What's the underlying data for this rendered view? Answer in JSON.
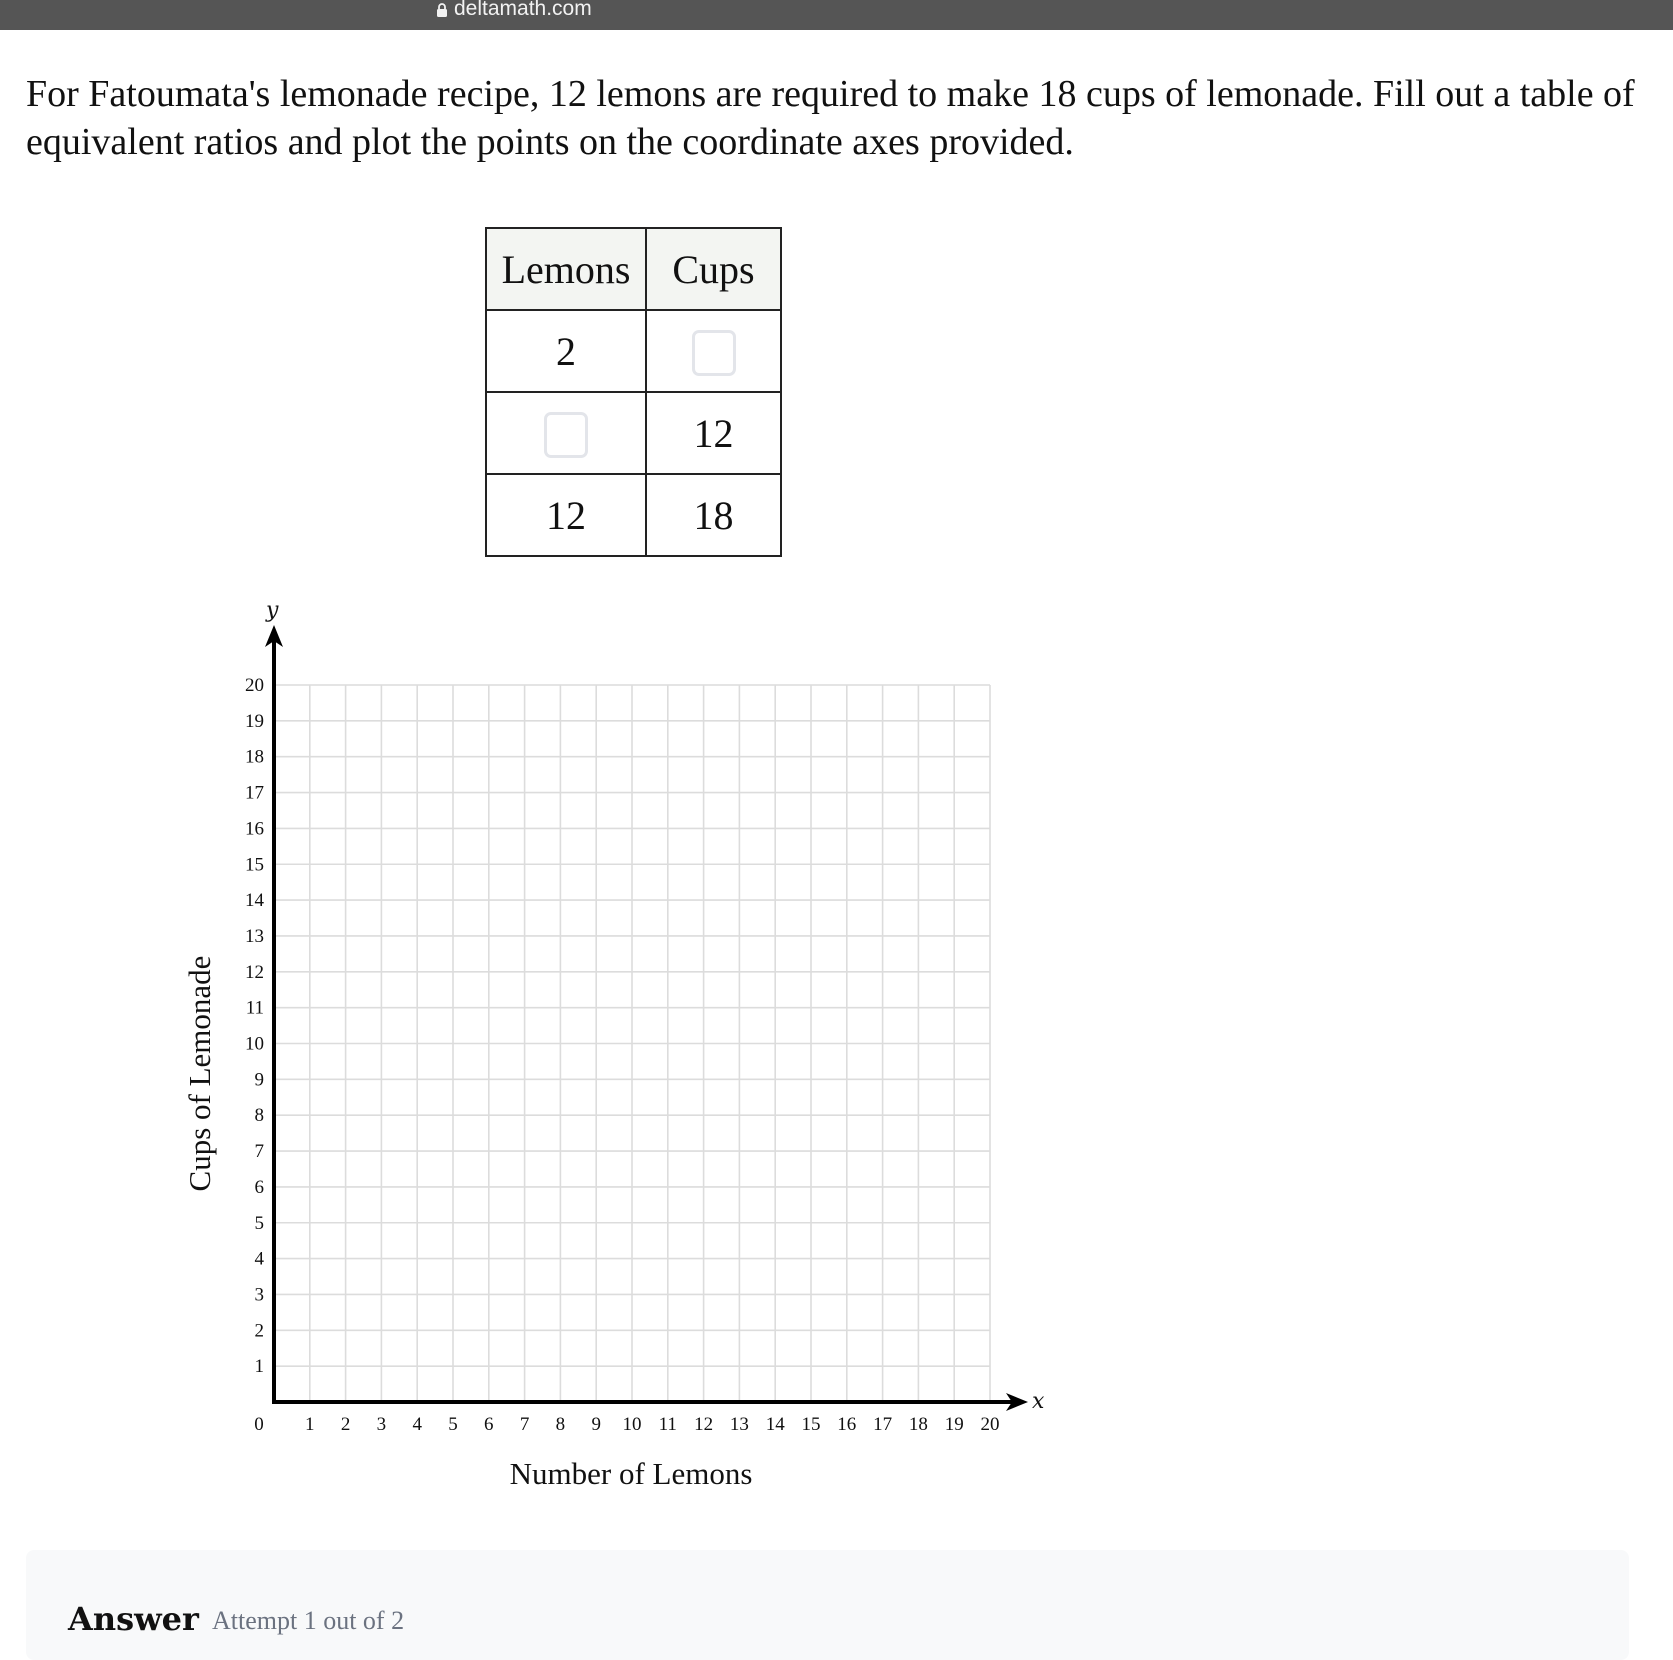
{
  "browser": {
    "url": "deltamath.com",
    "lock_icon": "lock-icon"
  },
  "problem": {
    "prompt": "For Fatoumata's lemonade recipe, 12 lemons are required to make 18 cups of lemonade. Fill out a table of equivalent ratios and plot the points on the coordinate axes provided."
  },
  "ratio_table": {
    "headers": [
      "Lemons",
      "Cups"
    ],
    "rows": [
      {
        "lemons": "2",
        "cups": ""
      },
      {
        "lemons": "",
        "cups": "12"
      },
      {
        "lemons": "12",
        "cups": "18"
      }
    ]
  },
  "chart_data": {
    "type": "scatter",
    "title": "",
    "xlabel": "Number of Lemons",
    "ylabel": "Cups of Lemonade",
    "x_axis_symbol": "x",
    "y_axis_symbol": "y",
    "xlim": [
      0,
      20
    ],
    "ylim": [
      0,
      20
    ],
    "x_ticks": [
      0,
      1,
      2,
      3,
      4,
      5,
      6,
      7,
      8,
      9,
      10,
      11,
      12,
      13,
      14,
      15,
      16,
      17,
      18,
      19,
      20
    ],
    "y_ticks": [
      1,
      2,
      3,
      4,
      5,
      6,
      7,
      8,
      9,
      10,
      11,
      12,
      13,
      14,
      15,
      16,
      17,
      18,
      19,
      20
    ],
    "grid": true,
    "points": []
  },
  "answer": {
    "label": "Answer",
    "attempt": "Attempt 1 out of 2"
  }
}
